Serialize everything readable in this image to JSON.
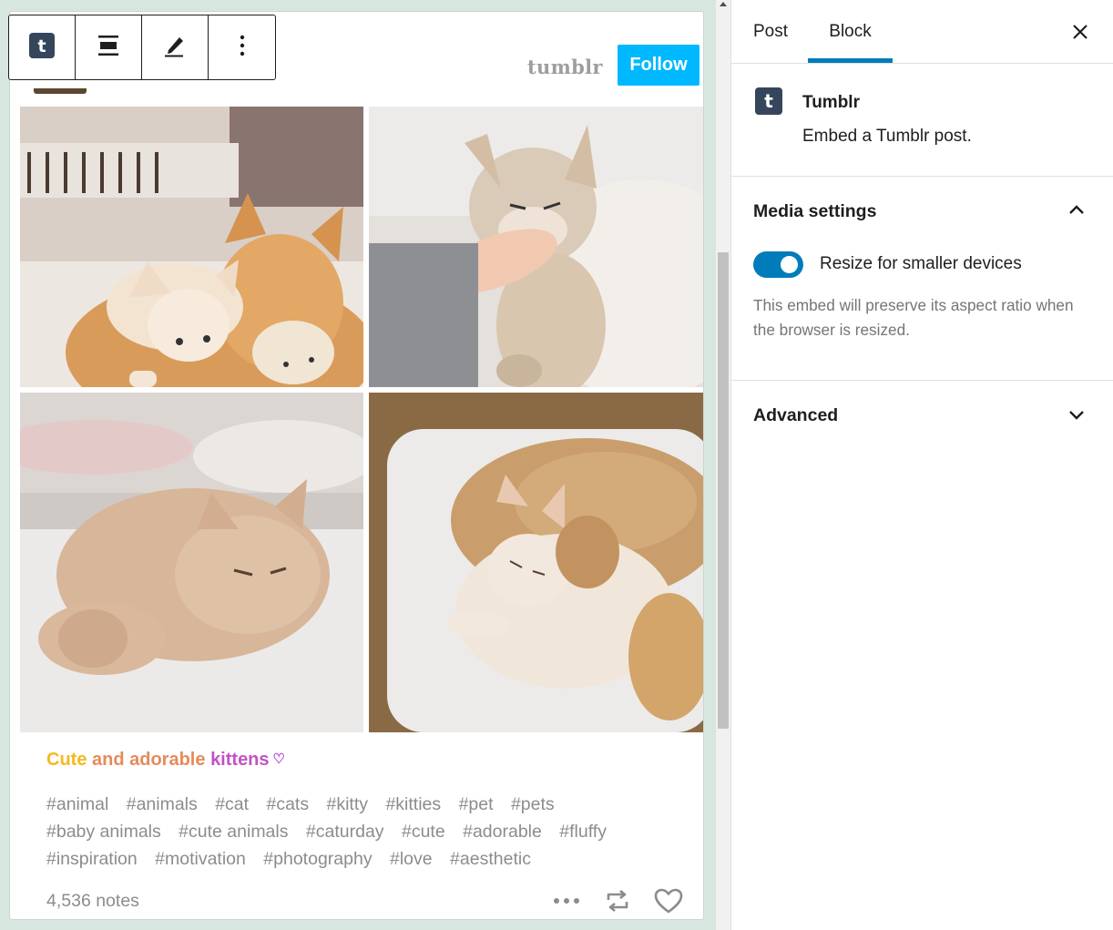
{
  "post": {
    "brand": "tumblr",
    "follow_label": "Follow",
    "title_words": [
      "Cute",
      "and adorable",
      "kittens"
    ],
    "heart": "♡",
    "tags": [
      "#animal",
      "#animals",
      "#cat",
      "#cats",
      "#kitty",
      "#kitties",
      "#pet",
      "#pets",
      "#baby animals",
      "#cute animals",
      "#caturday",
      "#cute",
      "#adorable",
      "#fluffy",
      "#inspiration",
      "#motivation",
      "#photography",
      "#love",
      "#aesthetic"
    ],
    "notes": "4,536 notes",
    "actions": [
      "more-icon",
      "reblog-icon",
      "like-icon"
    ]
  },
  "toolbar": {
    "buttons": [
      "tumblr-block-icon",
      "align-icon",
      "edit-icon",
      "more-options-icon"
    ]
  },
  "sidebar": {
    "tabs": [
      "Post",
      "Block"
    ],
    "active_tab": "Block",
    "block": {
      "title": "Tumblr",
      "description": "Embed a Tumblr post."
    },
    "media_settings": {
      "title": "Media settings",
      "expanded": true,
      "toggle_label": "Resize for smaller devices",
      "toggle_on": true,
      "help": "This embed will preserve its aspect ratio when the browser is resized."
    },
    "advanced": {
      "title": "Advanced",
      "expanded": false
    }
  },
  "colors": {
    "accent": "#007cba",
    "follow": "#00b8ff",
    "canvas_bg": "#d7e6df",
    "title_gradient": [
      "#f5b91f",
      "#e58b5c",
      "#c252c5"
    ]
  }
}
